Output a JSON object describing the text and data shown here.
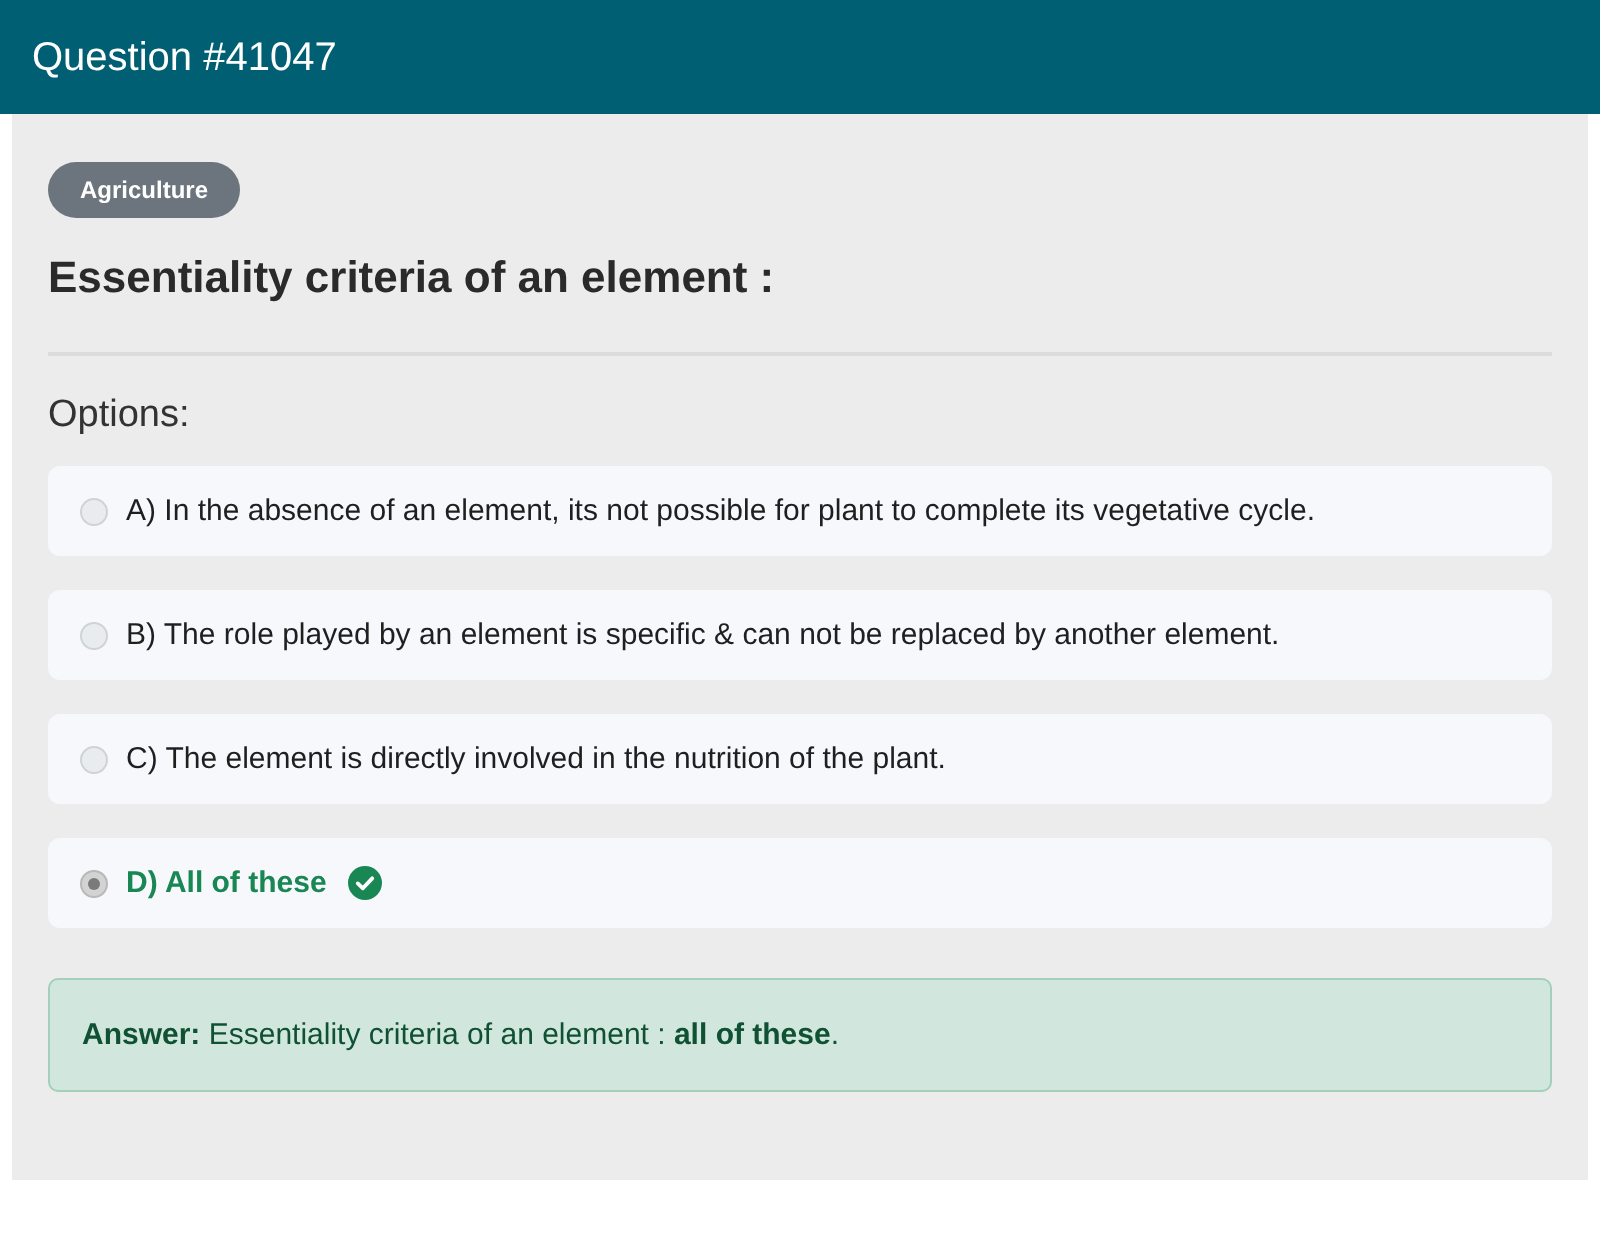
{
  "header": {
    "title": "Question #41047"
  },
  "question": {
    "category": "Agriculture",
    "text": "Essentiality criteria of an element :"
  },
  "options_label": "Options:",
  "options": [
    {
      "text": "A) In the absence of an element, its not possible for plant to complete its vegetative cycle.",
      "selected": false,
      "correct": false
    },
    {
      "text": "B) The role played by an element is specific & can not be replaced by another element.",
      "selected": false,
      "correct": false
    },
    {
      "text": "C) The element is directly involved in the nutrition of the plant.",
      "selected": false,
      "correct": false
    },
    {
      "text": "D) All of these",
      "selected": true,
      "correct": true
    }
  ],
  "answer": {
    "text": "**Answer:** Essentiality criteria of an element : **all of these**."
  }
}
